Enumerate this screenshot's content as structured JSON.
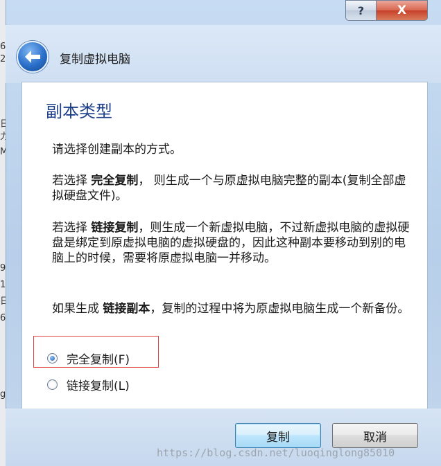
{
  "background_window": {
    "fragments": [
      "6",
      "2",
      "日",
      "力",
      "M",
      "9",
      "1",
      "日",
      "6",
      "g"
    ]
  },
  "window": {
    "help_label": "?",
    "close_label": "X"
  },
  "header": {
    "title": "复制虚拟电脑"
  },
  "content": {
    "section_title": "副本类型",
    "intro": "请选择创建副本的方式。",
    "full_clone_desc": {
      "prefix": "若选择 ",
      "bold": "完全复制",
      "suffix": "，  则生成一个与原虚拟电脑完整的副本(复制全部虚拟硬盘文件)。"
    },
    "linked_clone_desc": {
      "prefix": "若选择 ",
      "bold": "链接复制",
      "suffix": "，则生成一个新虚拟电脑，不过新虚拟电脑的虚拟硬盘是绑定到原虚拟电脑的虚拟硬盘的，因此这种副本要移动到别的电脑上的时候，需要将原虚拟电脑一并移动。"
    },
    "snapshot_desc": {
      "prefix": "如果生成 ",
      "bold": "链接副本",
      "suffix": "，复制的过程中将为原虚拟电脑生成一个新备份。"
    },
    "options": [
      {
        "label": "完全复制(F)",
        "selected": true
      },
      {
        "label": "链接复制(L)",
        "selected": false
      }
    ]
  },
  "footer": {
    "copy_button": "复制",
    "cancel_button": "取消"
  },
  "watermark": "https://blog.csdn.net/luoqinglong85010"
}
